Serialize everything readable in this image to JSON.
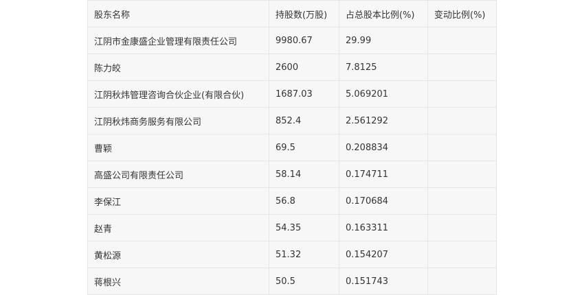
{
  "table": {
    "headers": [
      "股东名称",
      "持股数(万股)",
      "占总股本比例(%)",
      "变动比例(%)"
    ],
    "rows": [
      [
        "江阴市金康盛企业管理有限责任公司",
        "9980.67",
        "29.99",
        ""
      ],
      [
        "陈力皎",
        "2600",
        "7.8125",
        ""
      ],
      [
        "江阴秋炜管理咨询合伙企业(有限合伙)",
        "1687.03",
        "5.069201",
        ""
      ],
      [
        "江阴秋炜商务服务有限公司",
        "852.4",
        "2.561292",
        ""
      ],
      [
        "曹颖",
        "69.5",
        "0.208834",
        ""
      ],
      [
        "高盛公司有限责任公司",
        "58.14",
        "0.174711",
        ""
      ],
      [
        "李保江",
        "56.8",
        "0.170684",
        ""
      ],
      [
        "赵青",
        "54.35",
        "0.163311",
        ""
      ],
      [
        "黄松源",
        "51.32",
        "0.154207",
        ""
      ],
      [
        "蒋根兴",
        "50.5",
        "0.151743",
        ""
      ]
    ]
  }
}
